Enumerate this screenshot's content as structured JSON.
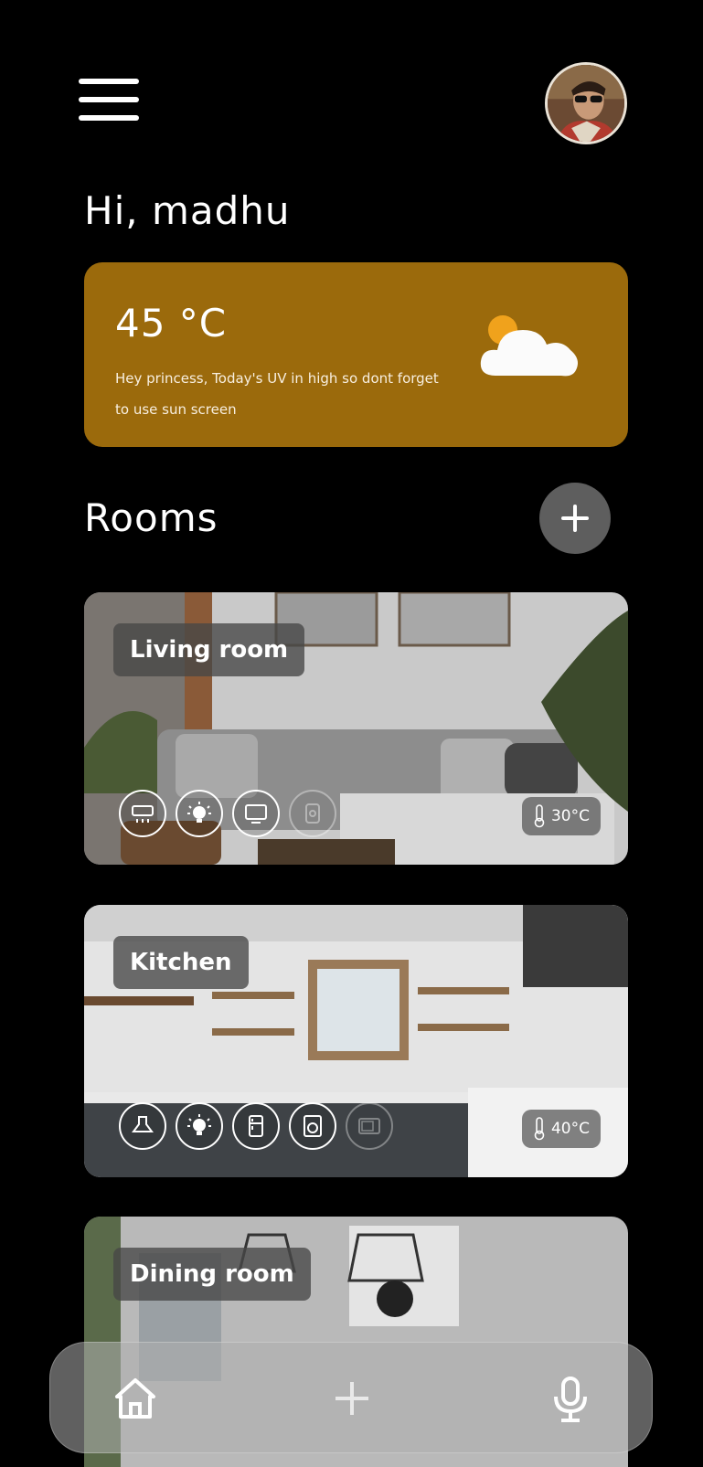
{
  "user": {
    "greeting": "Hi, madhu"
  },
  "weather": {
    "temperature": "45 °C",
    "message": "Hey princess, Today's UV in high so dont forget to use sun screen",
    "icon": "partly-cloudy-icon",
    "card_color": "#9b6a0c"
  },
  "rooms": {
    "title": "Rooms",
    "items": [
      {
        "name": "Living room",
        "temperature": "30°C",
        "devices": [
          "air-conditioner-icon",
          "light-bulb-icon",
          "tv-icon",
          "smart-plug-icon"
        ]
      },
      {
        "name": "Kitchen",
        "temperature": "40°C",
        "devices": [
          "chimney-hood-icon",
          "light-bulb-icon",
          "refrigerator-icon",
          "washing-machine-icon",
          "microwave-icon"
        ]
      },
      {
        "name": "Dining room"
      }
    ]
  },
  "bottom_nav": {
    "items": [
      "home-icon",
      "add-icon",
      "microphone-icon"
    ]
  }
}
